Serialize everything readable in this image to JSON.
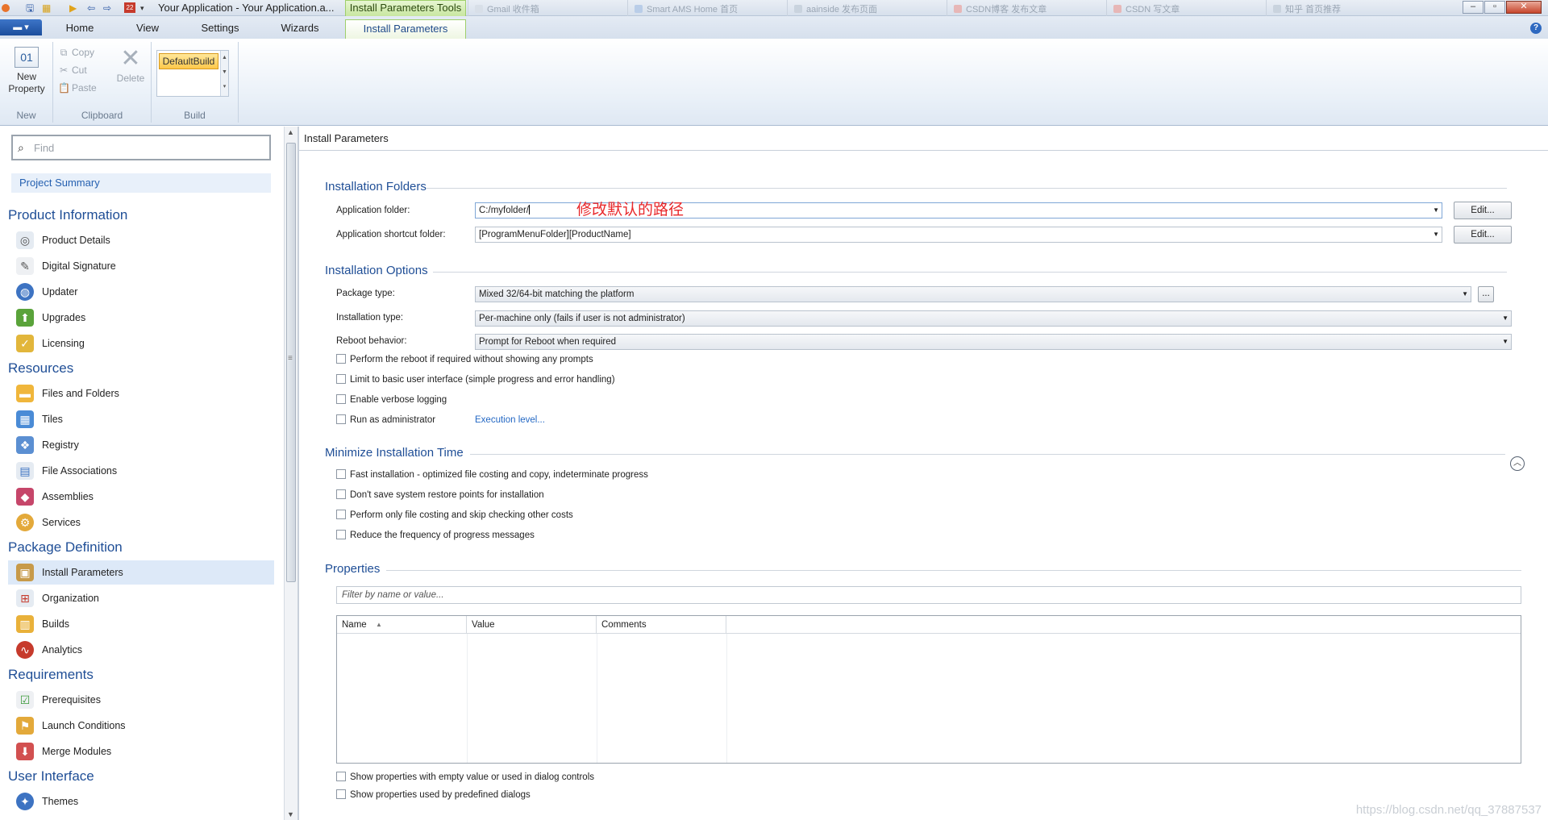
{
  "titlebar": {
    "app_title": "Your Application - Your Application.a...",
    "context_tab_title": "Install Parameters Tools",
    "browser_tabs": [
      "Gmail 收件箱",
      "Smart AMS Home 首页",
      "aainside 发布页面",
      "CSDN博客 发布文章",
      "CSDN 写文章",
      "知乎 首页推荐"
    ],
    "qa_icons": [
      "save-icon",
      "build-icon",
      "run-icon",
      "undo-icon",
      "redo-icon",
      "calendar-icon",
      "dropdown-icon"
    ],
    "qa_calendar_text": "22"
  },
  "ribbon": {
    "tabs": [
      "Home",
      "View",
      "Settings",
      "Wizards",
      "Install Parameters"
    ],
    "active_tab": "Install Parameters",
    "app_menu_glyph": "▾",
    "groups": {
      "new": {
        "label": "New",
        "new_property_icon_text": "01",
        "new_property_line1": "New",
        "new_property_line2": "Property"
      },
      "clipboard": {
        "label": "Clipboard",
        "copy": "Copy",
        "cut": "Cut",
        "paste": "Paste",
        "delete": "Delete"
      },
      "build": {
        "label": "Build",
        "selected_build": "DefaultBuild"
      }
    }
  },
  "sidebar": {
    "find_placeholder": "Find",
    "project_summary": "Project Summary",
    "sections": [
      {
        "title": "Product Information",
        "items": [
          "Product Details",
          "Digital Signature",
          "Updater",
          "Upgrades",
          "Licensing"
        ]
      },
      {
        "title": "Resources",
        "items": [
          "Files and Folders",
          "Tiles",
          "Registry",
          "File Associations",
          "Assemblies",
          "Services"
        ]
      },
      {
        "title": "Package Definition",
        "items": [
          "Install Parameters",
          "Organization",
          "Builds",
          "Analytics"
        ]
      },
      {
        "title": "Requirements",
        "items": [
          "Prerequisites",
          "Launch Conditions",
          "Merge Modules"
        ]
      },
      {
        "title": "User Interface",
        "items": [
          "Themes"
        ]
      }
    ],
    "selected_item": "Install Parameters"
  },
  "main": {
    "header": "Install Parameters",
    "installation_folders": {
      "title": "Installation Folders",
      "app_folder_label": "Application folder:",
      "app_folder_value": "C:/myfolder/",
      "shortcut_label": "Application shortcut folder:",
      "shortcut_value": "[ProgramMenuFolder][ProductName]",
      "edit_label": "Edit..."
    },
    "annotation": "修改默认的路径",
    "installation_options": {
      "title": "Installation Options",
      "package_type_label": "Package type:",
      "package_type_value": "Mixed 32/64-bit matching the platform",
      "installation_type_label": "Installation type:",
      "installation_type_value": "Per-machine only (fails if user is not administrator)",
      "reboot_label": "Reboot behavior:",
      "reboot_value": "Prompt for Reboot when required",
      "more_button": "...",
      "checks": [
        "Perform the reboot if required without showing any prompts",
        "Limit to basic user interface (simple progress and error handling)",
        "Enable verbose logging",
        "Run as administrator"
      ],
      "execution_link": "Execution level..."
    },
    "minimize": {
      "title": "Minimize Installation Time",
      "checks": [
        "Fast installation - optimized file costing and copy, indeterminate progress",
        "Don't save system restore points for installation",
        "Perform only file costing and skip checking other costs",
        "Reduce the frequency of progress messages"
      ]
    },
    "properties": {
      "title": "Properties",
      "filter_placeholder": "Filter by name or value...",
      "columns": [
        "Name",
        "Value",
        "Comments"
      ],
      "bottom_checks": [
        "Show properties with empty value or used in dialog controls",
        "Show properties used by predefined dialogs"
      ]
    },
    "watermark": "https://blog.csdn.net/qq_37887537"
  },
  "colors": {
    "accent": "#1f4e96",
    "context_tab": "#9fcf6b",
    "annotation": "#e8282b",
    "selection": "#dde9f8"
  }
}
